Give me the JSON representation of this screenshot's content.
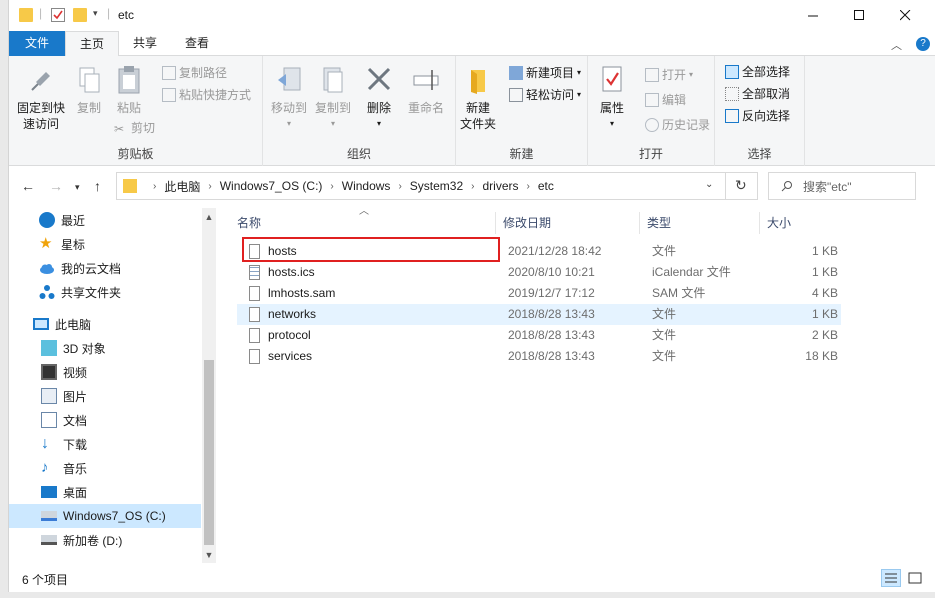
{
  "window": {
    "title": "etc"
  },
  "ribbon_tabs": [
    "文件",
    "主页",
    "共享",
    "查看"
  ],
  "ribbon": {
    "clipboard": {
      "pin_label": "固定到快\n速访问",
      "copy": "复制",
      "paste": "粘贴",
      "copy_path": "复制路径",
      "paste_shortcut": "粘贴快捷方式",
      "cut": "剪切",
      "group": "剪贴板"
    },
    "organize": {
      "move_to": "移动到",
      "copy_to": "复制到",
      "delete": "删除",
      "rename": "重命名",
      "group": "组织"
    },
    "new": {
      "new_folder": "新建\n文件夹",
      "new_item": "新建项目",
      "easy_access": "轻松访问",
      "group": "新建"
    },
    "open": {
      "properties": "属性",
      "open": "打开",
      "edit": "编辑",
      "history": "历史记录",
      "group": "打开"
    },
    "select": {
      "select_all": "全部选择",
      "select_none": "全部取消",
      "invert": "反向选择",
      "group": "选择"
    }
  },
  "address": {
    "crumbs": [
      "此电脑",
      "Windows7_OS (C:)",
      "Windows",
      "System32",
      "drivers",
      "etc"
    ]
  },
  "search": {
    "placeholder": "搜索\"etc\""
  },
  "nav": {
    "items": [
      {
        "label": "最近",
        "icon": "recent-icon"
      },
      {
        "label": "星标",
        "icon": "star-icon"
      },
      {
        "label": "我的云文档",
        "icon": "cloud-icon"
      },
      {
        "label": "共享文件夹",
        "icon": "share-icon"
      },
      {
        "label": "此电脑",
        "icon": "computer-icon"
      },
      {
        "label": "3D 对象",
        "icon": "3d-objects-icon"
      },
      {
        "label": "视频",
        "icon": "video-icon"
      },
      {
        "label": "图片",
        "icon": "pictures-icon"
      },
      {
        "label": "文档",
        "icon": "documents-icon"
      },
      {
        "label": "下载",
        "icon": "download-icon"
      },
      {
        "label": "音乐",
        "icon": "music-icon"
      },
      {
        "label": "桌面",
        "icon": "desktop-icon"
      },
      {
        "label": "Windows7_OS (C:)",
        "icon": "drive-c-icon"
      },
      {
        "label": "新加卷 (D:)",
        "icon": "drive-d-icon"
      }
    ]
  },
  "columns": [
    "名称",
    "修改日期",
    "类型",
    "大小"
  ],
  "files": [
    {
      "name": "hosts",
      "date": "2021/12/28 18:42",
      "type": "文件",
      "size": "1 KB"
    },
    {
      "name": "hosts.ics",
      "date": "2020/8/10 10:21",
      "type": "iCalendar 文件",
      "size": "1 KB"
    },
    {
      "name": "lmhosts.sam",
      "date": "2019/12/7 17:12",
      "type": "SAM 文件",
      "size": "4 KB"
    },
    {
      "name": "networks",
      "date": "2018/8/28 13:43",
      "type": "文件",
      "size": "1 KB"
    },
    {
      "name": "protocol",
      "date": "2018/8/28 13:43",
      "type": "文件",
      "size": "2 KB"
    },
    {
      "name": "services",
      "date": "2018/8/28 13:43",
      "type": "文件",
      "size": "18 KB"
    }
  ],
  "status": {
    "count": "6 个项目"
  },
  "colors": {
    "accent": "#1979ca",
    "selection": "#cce8ff",
    "hover": "#e5f3ff",
    "highlight_box": "#e02020",
    "folder": "#f7c948"
  }
}
